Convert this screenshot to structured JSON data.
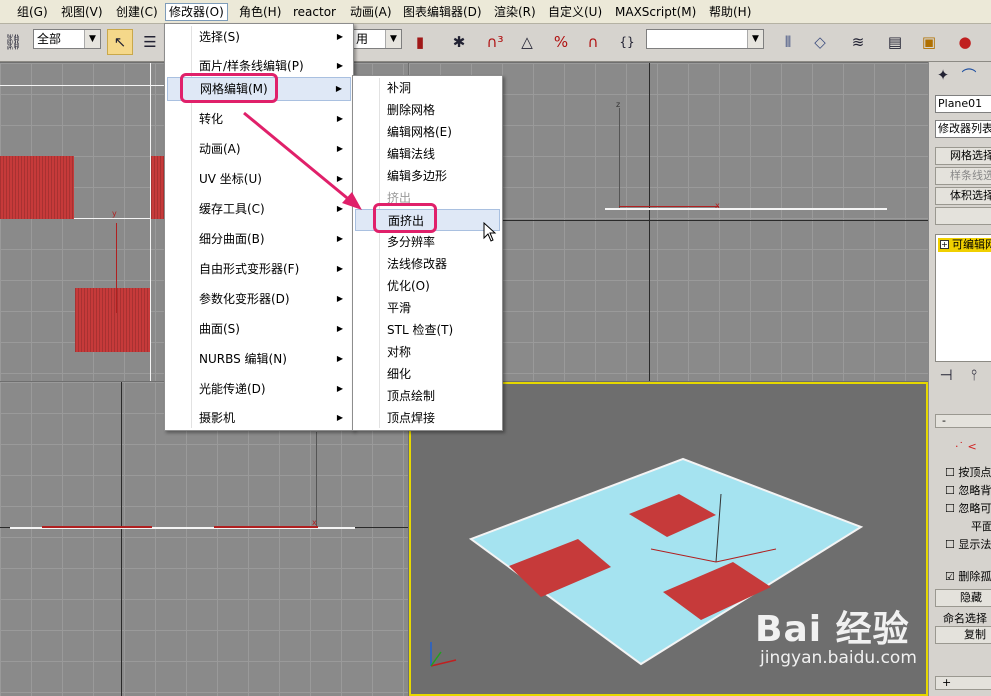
{
  "menubar": {
    "items": [
      "组(G)",
      "视图(V)",
      "创建(C)",
      "修改器(O)",
      "角色(H)",
      "reactor",
      "动画(A)",
      "图表编辑器(D)",
      "渲染(R)",
      "自定义(U)",
      "MAXScript(M)",
      "帮助(H)"
    ]
  },
  "toolbar": {
    "selection_filter": "全部",
    "combo2_partial": "用",
    "combo3": ""
  },
  "modifiers_menu": {
    "items": [
      {
        "label": "选择(S)",
        "has_sub": true
      },
      {
        "label": "面片/样条线编辑(P)",
        "has_sub": true
      },
      {
        "label": "网格编辑(M)",
        "has_sub": true
      },
      {
        "label": "转化",
        "has_sub": true
      },
      {
        "label": "动画(A)",
        "has_sub": true
      },
      {
        "label": "UV 坐标(U)",
        "has_sub": true
      },
      {
        "label": "缓存工具(C)",
        "has_sub": true
      },
      {
        "label": "细分曲面(B)",
        "has_sub": true
      },
      {
        "label": "自由形式变形器(F)",
        "has_sub": true
      },
      {
        "label": "参数化变形器(D)",
        "has_sub": true
      },
      {
        "label": "曲面(S)",
        "has_sub": true
      },
      {
        "label": "NURBS 编辑(N)",
        "has_sub": true
      },
      {
        "label": "光能传递(D)",
        "has_sub": true
      },
      {
        "label": "摄影机",
        "has_sub": true
      }
    ]
  },
  "mesh_edit_submenu": {
    "items": [
      "补洞",
      "删除网格",
      "编辑网格(E)",
      "编辑法线",
      "编辑多边形",
      "挤出",
      "面挤出",
      "多分辨率",
      "法线修改器",
      "优化(O)",
      "平滑",
      "STL 检查(T)",
      "对称",
      "细化",
      "顶点绘制",
      "顶点焊接"
    ]
  },
  "panel": {
    "object_name": "Plane01",
    "modifier_list": "修改器列表",
    "buttons": [
      "网格选择",
      "样条线选择",
      "体积选择"
    ],
    "stack_item": "可编辑网格",
    "options": [
      "按顶点",
      "忽略背",
      "忽略可",
      "平面",
      "显示法"
    ],
    "delete_isolated": "删除孤",
    "hide": "隐藏",
    "named_sel": "命名选择",
    "copy": "复制",
    "minus": "-",
    "plus": "+"
  },
  "axes": {
    "x": "x",
    "y": "y",
    "z": "z"
  },
  "watermark": {
    "brand": "Bai 经验",
    "url": "jingyan.baidu.com"
  },
  "colors": {
    "accent_ring": "#e0206a",
    "plane": "#a5e3f0",
    "red": "#c63a3a",
    "active_viewport": "#e6d800"
  }
}
